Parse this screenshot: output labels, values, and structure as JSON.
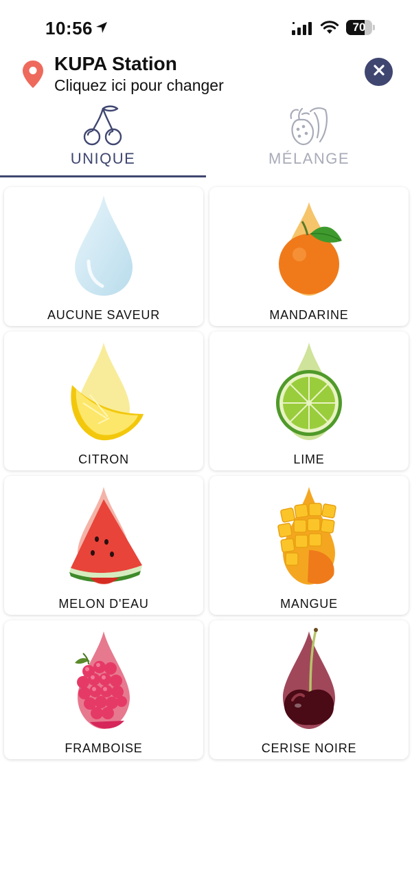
{
  "status_bar": {
    "time": "10:56",
    "battery": "70",
    "battery_level": 0.7
  },
  "header": {
    "station_name": "KUPA Station",
    "subtitle": "Cliquez ici pour changer"
  },
  "tabs": [
    {
      "label": "UNIQUE",
      "icon": "cherry-icon",
      "active": true
    },
    {
      "label": "MÉLANGE",
      "icon": "fruit-mix-icon",
      "active": false
    }
  ],
  "flavors": [
    {
      "label": "AUCUNE SAVEUR",
      "icon": "water-drop-icon",
      "color": "#cfe8f3"
    },
    {
      "label": "MANDARINE",
      "icon": "mandarin-icon",
      "color": "#f07a1a"
    },
    {
      "label": "CITRON",
      "icon": "lemon-icon",
      "color": "#f7d21c"
    },
    {
      "label": "LIME",
      "icon": "lime-icon",
      "color": "#8cc63f"
    },
    {
      "label": "MELON D'EAU",
      "icon": "watermelon-icon",
      "color": "#e8443a"
    },
    {
      "label": "MANGUE",
      "icon": "mango-icon",
      "color": "#f4a621"
    },
    {
      "label": "FRAMBOISE",
      "icon": "raspberry-icon",
      "color": "#e0325f"
    },
    {
      "label": "CERISE NOIRE",
      "icon": "black-cherry-icon",
      "color": "#5a0f1c"
    }
  ],
  "colors": {
    "accent": "#3f4670",
    "inactive_tab": "#a8abb8",
    "pin": "#ee6a5c"
  }
}
